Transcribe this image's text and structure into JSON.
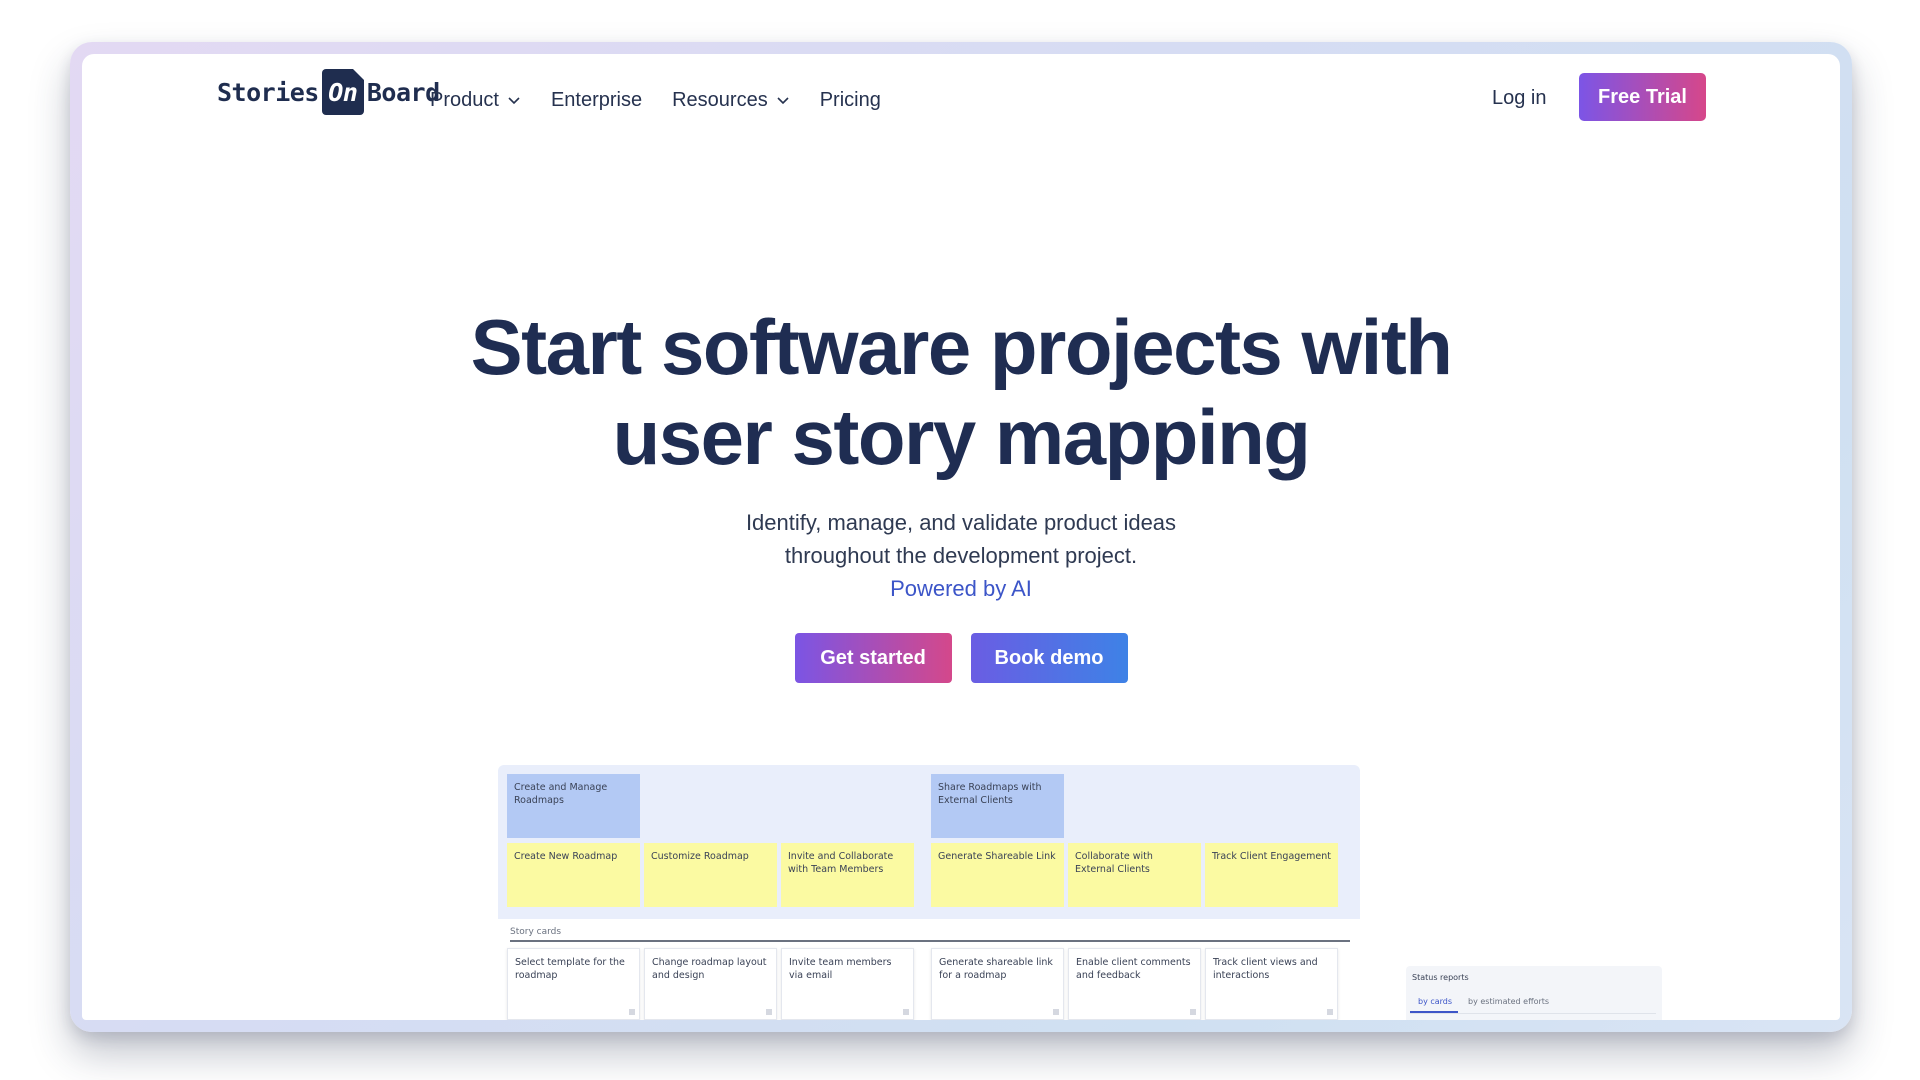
{
  "nav": {
    "logo": {
      "part1": "Stories",
      "part2": "On",
      "part3": "Board"
    },
    "items": [
      {
        "label": "Product",
        "has_dropdown": true
      },
      {
        "label": "Enterprise",
        "has_dropdown": false
      },
      {
        "label": "Resources",
        "has_dropdown": true
      },
      {
        "label": "Pricing",
        "has_dropdown": false
      }
    ],
    "login_label": "Log in",
    "trial_label": "Free Trial"
  },
  "hero": {
    "title_line1": "Start software projects with",
    "title_line2": "user story mapping",
    "subtitle_line1": "Identify, manage, and validate product ideas",
    "subtitle_line2": "throughout the development project.",
    "ai_text": "Powered by AI",
    "cta_primary": "Get started",
    "cta_secondary": "Book demo"
  },
  "story_map": {
    "epics": [
      {
        "label": "Create and Manage Roadmaps"
      },
      {
        "label": "Share Roadmaps with External Clients"
      }
    ],
    "features": [
      {
        "label": "Create New Roadmap"
      },
      {
        "label": "Customize Roadmap"
      },
      {
        "label": "Invite and Collaborate with Team Members"
      },
      {
        "label": "Generate Shareable Link"
      },
      {
        "label": "Collaborate with External Clients"
      },
      {
        "label": "Track Client Engagement"
      }
    ],
    "section_label": "Story cards",
    "stories": [
      {
        "label": "Select template for the roadmap"
      },
      {
        "label": "Change roadmap layout and design"
      },
      {
        "label": "Invite team members via email"
      },
      {
        "label": "Generate shareable link for a roadmap"
      },
      {
        "label": "Enable client comments and feedback"
      },
      {
        "label": "Track client views and interactions"
      }
    ]
  },
  "status_reports": {
    "title": "Status reports",
    "tabs": [
      "by cards",
      "by estimated efforts"
    ],
    "active_tab": "by cards"
  },
  "colors": {
    "brand_navy": "#1f2d52",
    "accent_purple": "#7c55e6",
    "accent_pink": "#d6478a",
    "accent_blue": "#3e82e6",
    "link_blue": "#3c55c8",
    "epic_blue": "#b3c9f4",
    "feature_yellow": "#fbfaa2"
  }
}
